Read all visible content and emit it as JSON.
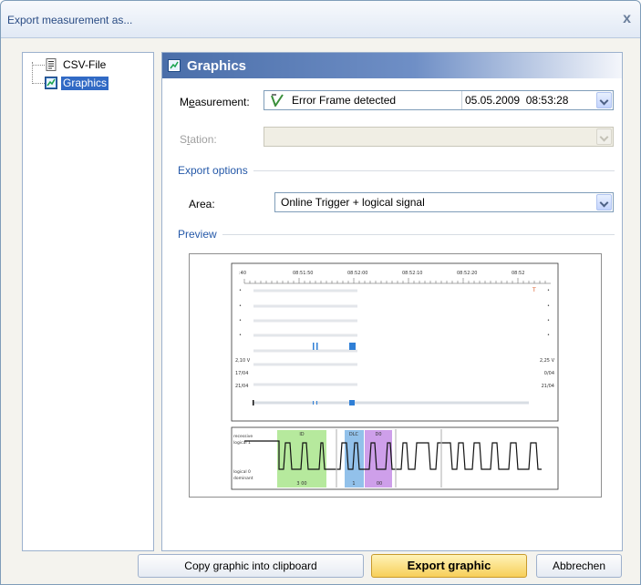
{
  "window": {
    "title": "Export measurement as...",
    "close_glyph": "x"
  },
  "tree": {
    "items": [
      {
        "label": "CSV-File",
        "icon": "csv-file-icon",
        "selected": false
      },
      {
        "label": "Graphics",
        "icon": "graphics-icon",
        "selected": true
      }
    ]
  },
  "panel": {
    "header": "Graphics",
    "measurement": {
      "label": "Measurement:",
      "value": "Error Frame detected",
      "timestamp": "05.05.2009  08:53:28"
    },
    "station": {
      "label": "Station:",
      "value": ""
    },
    "export_options": {
      "title": "Export options",
      "area": {
        "label": "Area:",
        "value": "Online Trigger + logical signal"
      }
    },
    "preview": {
      "title": "Preview",
      "time_axis_labels": [
        ":40",
        "08:51:50",
        "08:52:00",
        "08:52:10",
        "08:52:20",
        "08:52"
      ],
      "trigger_marker": "T",
      "left_values": [
        "2,10 V",
        "17/04",
        "21/04"
      ],
      "right_values": [
        "2,25 V",
        "0/04",
        "21/04"
      ],
      "signal_levels": [
        "recessive",
        "logical 1",
        "logical 0",
        "dominant"
      ],
      "frame_fields": [
        {
          "name": "ID",
          "value": "3 00",
          "color": "#a9e58c"
        },
        {
          "name": "DLC",
          "value": "1",
          "color": "#7fb6e6"
        },
        {
          "name": "D0",
          "value": "00",
          "color": "#c58ee6"
        }
      ]
    }
  },
  "buttons": {
    "copy": "Copy graphic into clipboard",
    "export": "Export graphic",
    "cancel": "Abbrechen"
  }
}
